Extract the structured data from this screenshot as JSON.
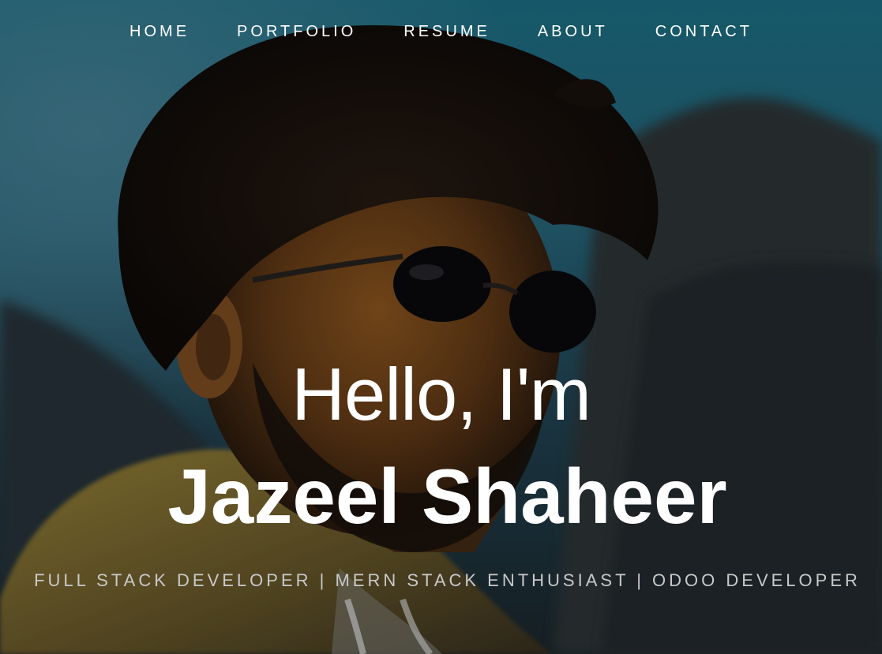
{
  "nav": {
    "items": [
      {
        "label": "HOME"
      },
      {
        "label": "PORTFOLIO"
      },
      {
        "label": "RESUME"
      },
      {
        "label": "ABOUT"
      },
      {
        "label": "CONTACT"
      }
    ]
  },
  "hero": {
    "greeting": "Hello, I'm",
    "name": "Jazeel Shaheer",
    "tagline": "FULL STACK DEVELOPER | MERN STACK ENTHUSIAST | ODOO DEVELOPER"
  },
  "colors": {
    "text": "#ffffff",
    "tagline": "#c9c9c9",
    "sky": "#1b7a95",
    "mountain": "#26323a",
    "hoodie": "#b99a3c"
  }
}
